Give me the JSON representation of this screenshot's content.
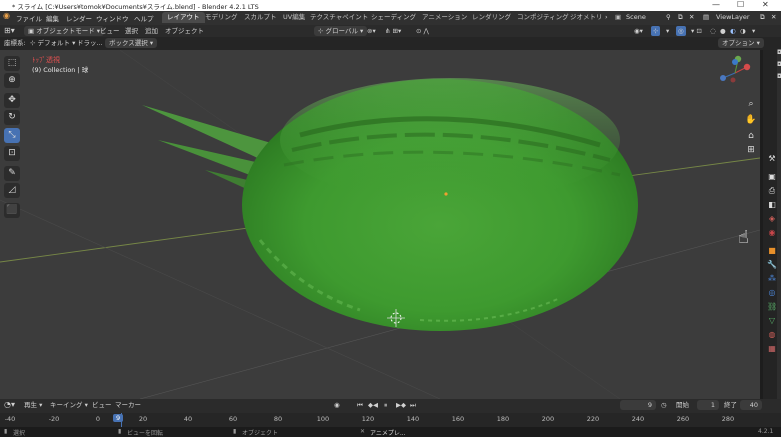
{
  "window": {
    "title": "* スライム [C:¥Users¥tomok¥Documents¥スライム.blend] - Blender 4.2.1 LTS"
  },
  "menubar": {
    "menus": [
      "ファイル",
      "編集",
      "レンダー",
      "ウィンドウ",
      "ヘルプ"
    ],
    "workspaces": [
      "レイアウト",
      "モデリング",
      "スカルプト",
      "UV編集",
      "テクスチャペイント",
      "シェーディング",
      "アニメーション",
      "レンダリング",
      "コンポジティング",
      "ジオメトリ"
    ],
    "scene": "Scene",
    "view_layer": "ViewLayer"
  },
  "header": {
    "mode": "オブジェクトモード",
    "menus": [
      "ビュー",
      "選択",
      "追加",
      "オブジェクト"
    ],
    "transform": "グローバル",
    "options": "オプション"
  },
  "tool_settings": {
    "axis_label": "座標系:",
    "orientation": "デフォルト",
    "drag_label": "ドラッ...",
    "select": "ボックス選択"
  },
  "viewport": {
    "view_name": "ﾄｯﾌﾟ透視",
    "collection": "(9) Collection | 球"
  },
  "timeline": {
    "playback": "再生",
    "keying": "キーイング",
    "view": "ビュー",
    "marker": "マーカー",
    "current_frame": "9",
    "start_label": "開始",
    "start": "1",
    "end_label": "終了",
    "end": "40",
    "ruler_ticks": [
      "-40",
      "-20",
      "0",
      "20",
      "40",
      "60",
      "80",
      "100",
      "120",
      "140",
      "160",
      "180",
      "200",
      "220",
      "240",
      "260",
      "280"
    ],
    "playhead": "9"
  },
  "statusbar": {
    "items": [
      "選択",
      "ビューを回転",
      "オブジェクト",
      "アニメプレ..."
    ],
    "version": "4.2.1"
  },
  "colors": {
    "accent": "#4772b3",
    "active_object_label": "#e05050",
    "slime": "#3f9a30"
  }
}
